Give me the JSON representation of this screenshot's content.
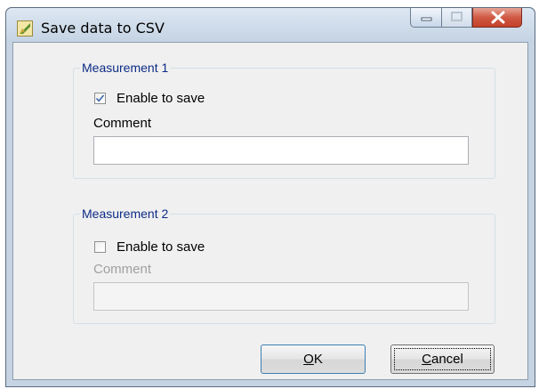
{
  "window": {
    "title": "Save data to CSV",
    "icon": "app-icon"
  },
  "measurement1": {
    "legend": "Measurement 1",
    "enable_label": "Enable to save",
    "enabled": true,
    "comment_label": "Comment",
    "comment_value": ""
  },
  "measurement2": {
    "legend": "Measurement 2",
    "enable_label": "Enable to save",
    "enabled": false,
    "comment_label": "Comment",
    "comment_value": ""
  },
  "buttons": {
    "ok_mnemonic": "O",
    "ok_rest": "K",
    "cancel_mnemonic": "C",
    "cancel_rest": "ancel"
  },
  "colors": {
    "group_legend": "#0c2b86",
    "close_button": "#c4412a"
  }
}
